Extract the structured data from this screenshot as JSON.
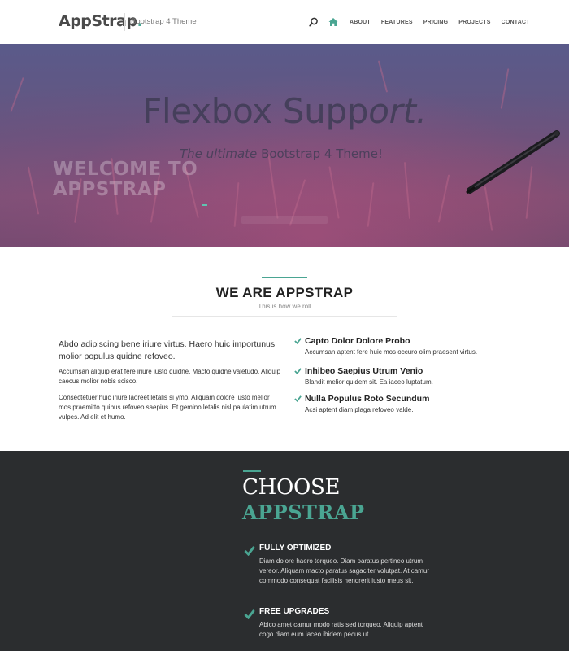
{
  "header": {
    "logo_main": "AppStrap",
    "logo_dot": ".",
    "tagline": "Bootstrap 4 Theme",
    "nav": [
      "ABOUT",
      "FEATURES",
      "PRICING",
      "PROJECTS",
      "CONTACT"
    ]
  },
  "hero": {
    "title_main": "Flexbox Supp",
    "title_italic": "ort.",
    "subtitle_italic": "The ultimate",
    "subtitle_rest": " Bootstrap 4 Theme!",
    "welcome_line1": "WELCOME TO",
    "welcome_line2": "APPSTRAP"
  },
  "about": {
    "title": "WE ARE APPSTRAP",
    "subtitle": "This is how we roll",
    "lead": "Abdo adipiscing bene iriure virtus. Haero huic importunus molior populus quidne refoveo.",
    "para1": "Accumsan aliquip erat fere iriure iusto quidne. Macto quidne valetudo. Aliquip caecus molior nobis scisco.",
    "para2": "Consectetuer huic iriure laoreet letalis si ymo. Aliquam dolore iusto melior mos praemitto quibus refoveo saepius. Et gemino letalis nisl paulatim utrum vulpes. Ad elit et humo.",
    "features": [
      {
        "title": "Capto Dolor Dolore Probo",
        "desc": "Accumsan aptent fere huic mos occuro olim praesent virtus."
      },
      {
        "title": "Inhibeo Saepius Utrum Venio",
        "desc": "Blandit melior quidem sit. Ea iaceo luptatum."
      },
      {
        "title": "Nulla Populus Roto Secundum",
        "desc": "Acsi aptent diam plaga refoveo valde."
      }
    ]
  },
  "choose": {
    "title_line1": "CHOOSE",
    "title_line2": "APPSTRAP",
    "items": [
      {
        "title": "FULLY OPTIMIZED",
        "desc": "Diam dolore haero torqueo. Diam paratus pertineo utrum vereor. Aliquam macto paratus sagaciter volutpat. At camur commodo consequat facilisis hendrerit iusto meus sit."
      },
      {
        "title": "FREE UPGRADES",
        "desc": "Abico amet camur modo ratis sed torqueo. Aliquip aptent cogo diam eum iaceo ibidem pecus ut."
      }
    ]
  },
  "colors": {
    "accent": "#4aa592",
    "dark_section": "#2b2d2f",
    "hero_tint": "#66557f"
  },
  "icons": [
    "search-icon",
    "home-icon",
    "check-icon",
    "pen-image"
  ]
}
